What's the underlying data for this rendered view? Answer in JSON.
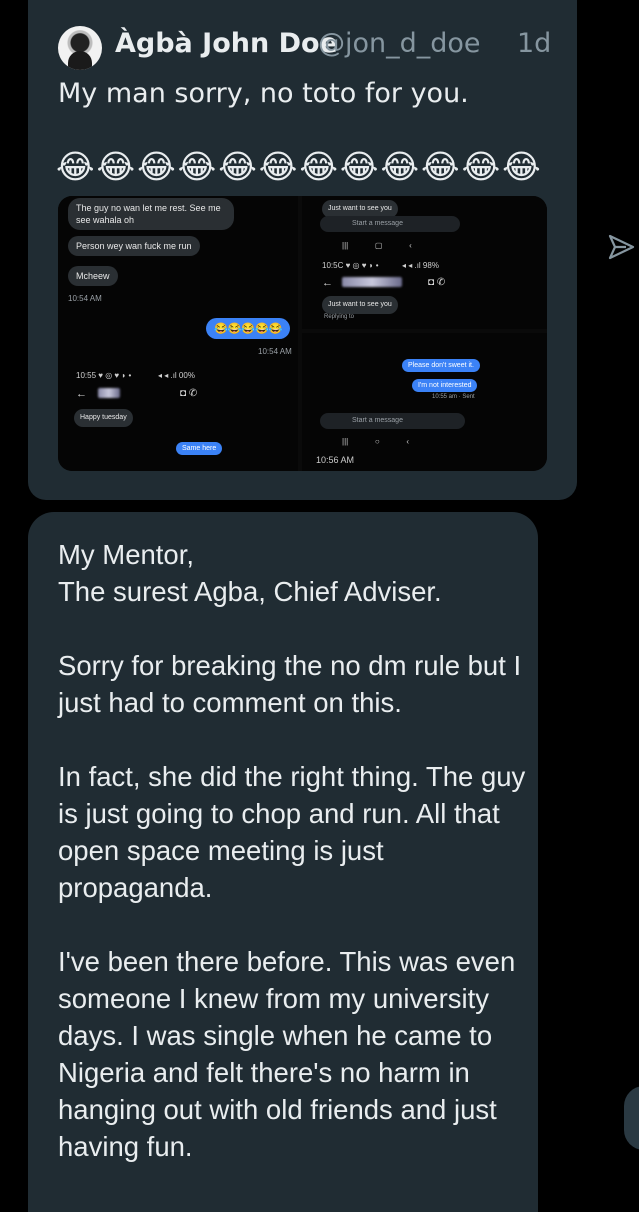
{
  "tweet": {
    "author_name": "Àgbà John Doe",
    "author_handle": "@jon_d_doe",
    "time": "1d",
    "text": "My man sorry, no toto for you.",
    "emojis": "😂😂😂😂😂😂😂😂😂😂😂😂"
  },
  "shot_left": {
    "msg1": "The guy no wan let me rest. See me see wahala oh",
    "msg2": "Person wey wan fuck me run",
    "msg3": "Mcheew",
    "time1": "10:54 AM",
    "sent_emojis": "😂😂😂😂😂",
    "time2": "10:54 AM",
    "status": "10:55 ♥ ◎ ♥ ◗ •",
    "battery": "◂ ◂ .ıl 00%",
    "msg4": "Happy tuesday",
    "msg5": "Same here"
  },
  "shot_right_top": {
    "msg": "Just want to see you",
    "compose": "Start a message",
    "status": "10:5C ♥ ◎ ♥ ◗ •",
    "battery": "◂ ◂ .ıl 98%",
    "msg2": "Just want to see you",
    "replying": "Replying to"
  },
  "shot_right_bottom": {
    "msg1": "Please don't sweet it.",
    "msg2": "I'm not interested",
    "seen": "10:55 am · Sent",
    "compose": "Start a message",
    "time": "10:56 AM"
  },
  "dm": {
    "text": "My Mentor,\nThe surest Agba, Chief Adviser.\n\nSorry for breaking the no dm rule but I just had to comment on this.\n\nIn fact, she did the right thing. The guy is just going to chop and run. All that open space meeting is just propaganda.\n\nI've been there before. This was even someone I knew from my university days. I was single when he came to Nigeria and felt there's no harm in hanging out with old friends and just having fun."
  },
  "colors": {
    "background": "#000000",
    "bubble": "#202c33",
    "text": "#e9edef",
    "muted": "#8696a0",
    "accent_blue": "#3b82f6"
  },
  "icons": {
    "send": "send-icon",
    "avatar": "avatar"
  }
}
